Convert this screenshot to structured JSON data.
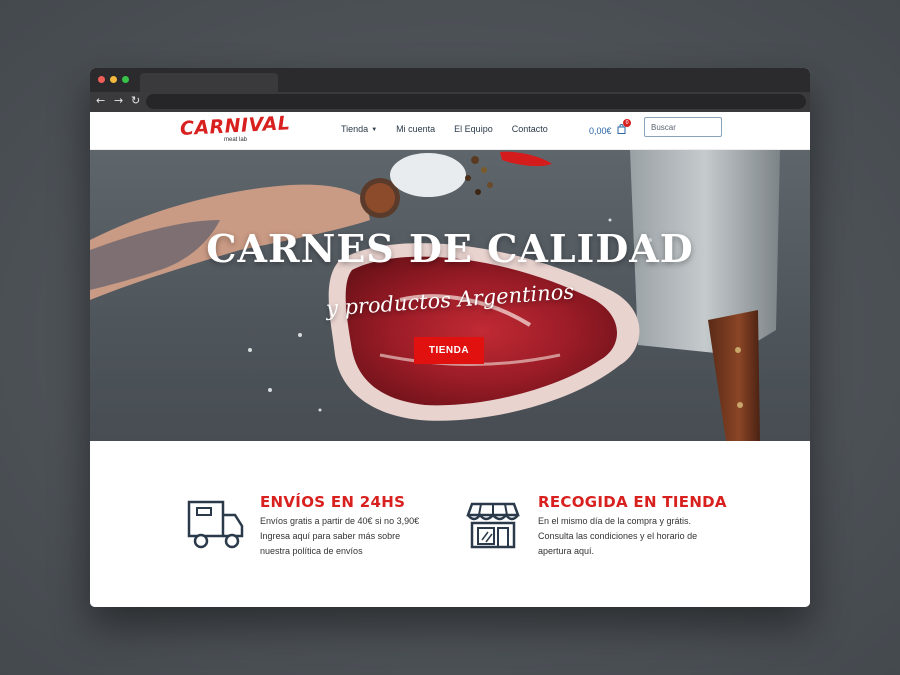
{
  "site": {
    "logo_text": "CARNIVAL",
    "logo_sub": "meat lab",
    "menu": [
      {
        "label": "Tienda"
      },
      {
        "label": "Mi cuenta"
      },
      {
        "label": "El Equipo"
      },
      {
        "label": "Contacto"
      }
    ],
    "cart_total": "0,00€",
    "cart_count": "0",
    "search_placeholder": "Buscar"
  },
  "hero": {
    "title": "CARNES DE CALIDAD",
    "subtitle": "y productos Argentinos",
    "button": "TIENDA"
  },
  "features": [
    {
      "icon": "delivery-truck-icon",
      "title": "ENVÍOS EN 24HS",
      "lines": [
        "Envíos gratis a partir de 40€ si no 3,90€",
        "Ingresa aquí para saber más sobre",
        "nuestra política de envíos"
      ]
    },
    {
      "icon": "storefront-icon",
      "title": "RECOGIDA EN TIENDA",
      "lines": [
        "En el mismo día de la compra y grátis.",
        "Consulta las condiciones y el horario de",
        "apertura aquí."
      ]
    }
  ],
  "colors": {
    "brand_red": "#d8201f",
    "button_red": "#e0110f",
    "nav_text": "#2b3a4a"
  }
}
